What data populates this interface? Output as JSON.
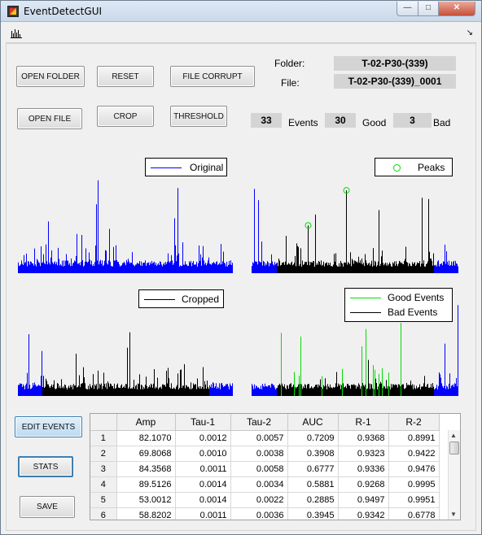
{
  "window": {
    "title": "EventDetectGUI"
  },
  "buttons": {
    "open_folder": "OPEN FOLDER",
    "reset": "RESET",
    "file_corrupt": "FILE CORRUPT",
    "open_file": "OPEN FILE",
    "crop": "CROP",
    "threshold": "THRESHOLD",
    "edit_events": "EDIT EVENTS",
    "stats": "STATS",
    "save": "SAVE"
  },
  "info": {
    "folder_label": "Folder:",
    "folder_value": "T-02-P30-(339)",
    "file_label": "File:",
    "file_value": "T-02-P30-(339)_0001",
    "events_count": "33",
    "events_label": "Events",
    "good_count": "30",
    "good_label": "Good",
    "bad_count": "3",
    "bad_label": "Bad"
  },
  "plots": {
    "original_legend": "Original",
    "peaks_legend": "Peaks",
    "cropped_legend": "Cropped",
    "good_events_legend": "Good Events",
    "bad_events_legend": "Bad Events"
  },
  "colors": {
    "original": "#0000ff",
    "peaks": "#00dd00",
    "cropped": "#000000",
    "good": "#00dd00",
    "bad": "#000000"
  },
  "table": {
    "columns": [
      "Amp",
      "Tau-1",
      "Tau-2",
      "AUC",
      "R-1",
      "R-2"
    ],
    "rows": [
      {
        "n": "1",
        "cells": [
          "82.1070",
          "0.0012",
          "0.0057",
          "0.7209",
          "0.9368",
          "0.8991"
        ]
      },
      {
        "n": "2",
        "cells": [
          "69.8068",
          "0.0010",
          "0.0038",
          "0.3908",
          "0.9323",
          "0.9422"
        ]
      },
      {
        "n": "3",
        "cells": [
          "84.3568",
          "0.0011",
          "0.0058",
          "0.6777",
          "0.9336",
          "0.9476"
        ]
      },
      {
        "n": "4",
        "cells": [
          "89.5126",
          "0.0014",
          "0.0034",
          "0.5881",
          "0.9268",
          "0.9995"
        ]
      },
      {
        "n": "5",
        "cells": [
          "53.0012",
          "0.0014",
          "0.0022",
          "0.2885",
          "0.9497",
          "0.9951"
        ]
      },
      {
        "n": "6",
        "cells": [
          "58.8202",
          "0.0011",
          "0.0036",
          "0.3945",
          "0.9342",
          "0.6778"
        ]
      }
    ]
  }
}
